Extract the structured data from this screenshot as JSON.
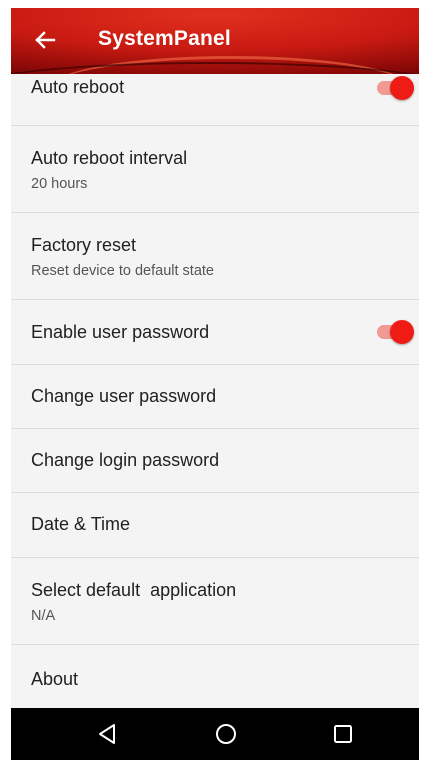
{
  "app_bar": {
    "title": "SystemPanel",
    "back_icon": "arrow-left-icon",
    "color": "#c81a12"
  },
  "settings": [
    {
      "title": "Auto reboot",
      "subtitle": "",
      "toggle": true
    },
    {
      "title": "Auto reboot interval",
      "subtitle": "20 hours",
      "toggle": null
    },
    {
      "title": "Factory reset",
      "subtitle": "Reset device to default state",
      "toggle": null
    },
    {
      "title": "Enable user password",
      "subtitle": "",
      "toggle": true
    },
    {
      "title": "Change user password",
      "subtitle": "",
      "toggle": null
    },
    {
      "title": "Change login password",
      "subtitle": "",
      "toggle": null
    },
    {
      "title": "Date & Time",
      "subtitle": "",
      "toggle": null
    },
    {
      "title": "Select default  application",
      "subtitle": "N/A",
      "toggle": null
    },
    {
      "title": "About",
      "subtitle": "",
      "toggle": null
    }
  ],
  "toggle_colors": {
    "thumb": "#ee1c14",
    "track": "#f19a94"
  },
  "nav_bar": {
    "buttons": [
      "back-triangle-icon",
      "home-circle-icon",
      "recents-square-icon"
    ]
  }
}
